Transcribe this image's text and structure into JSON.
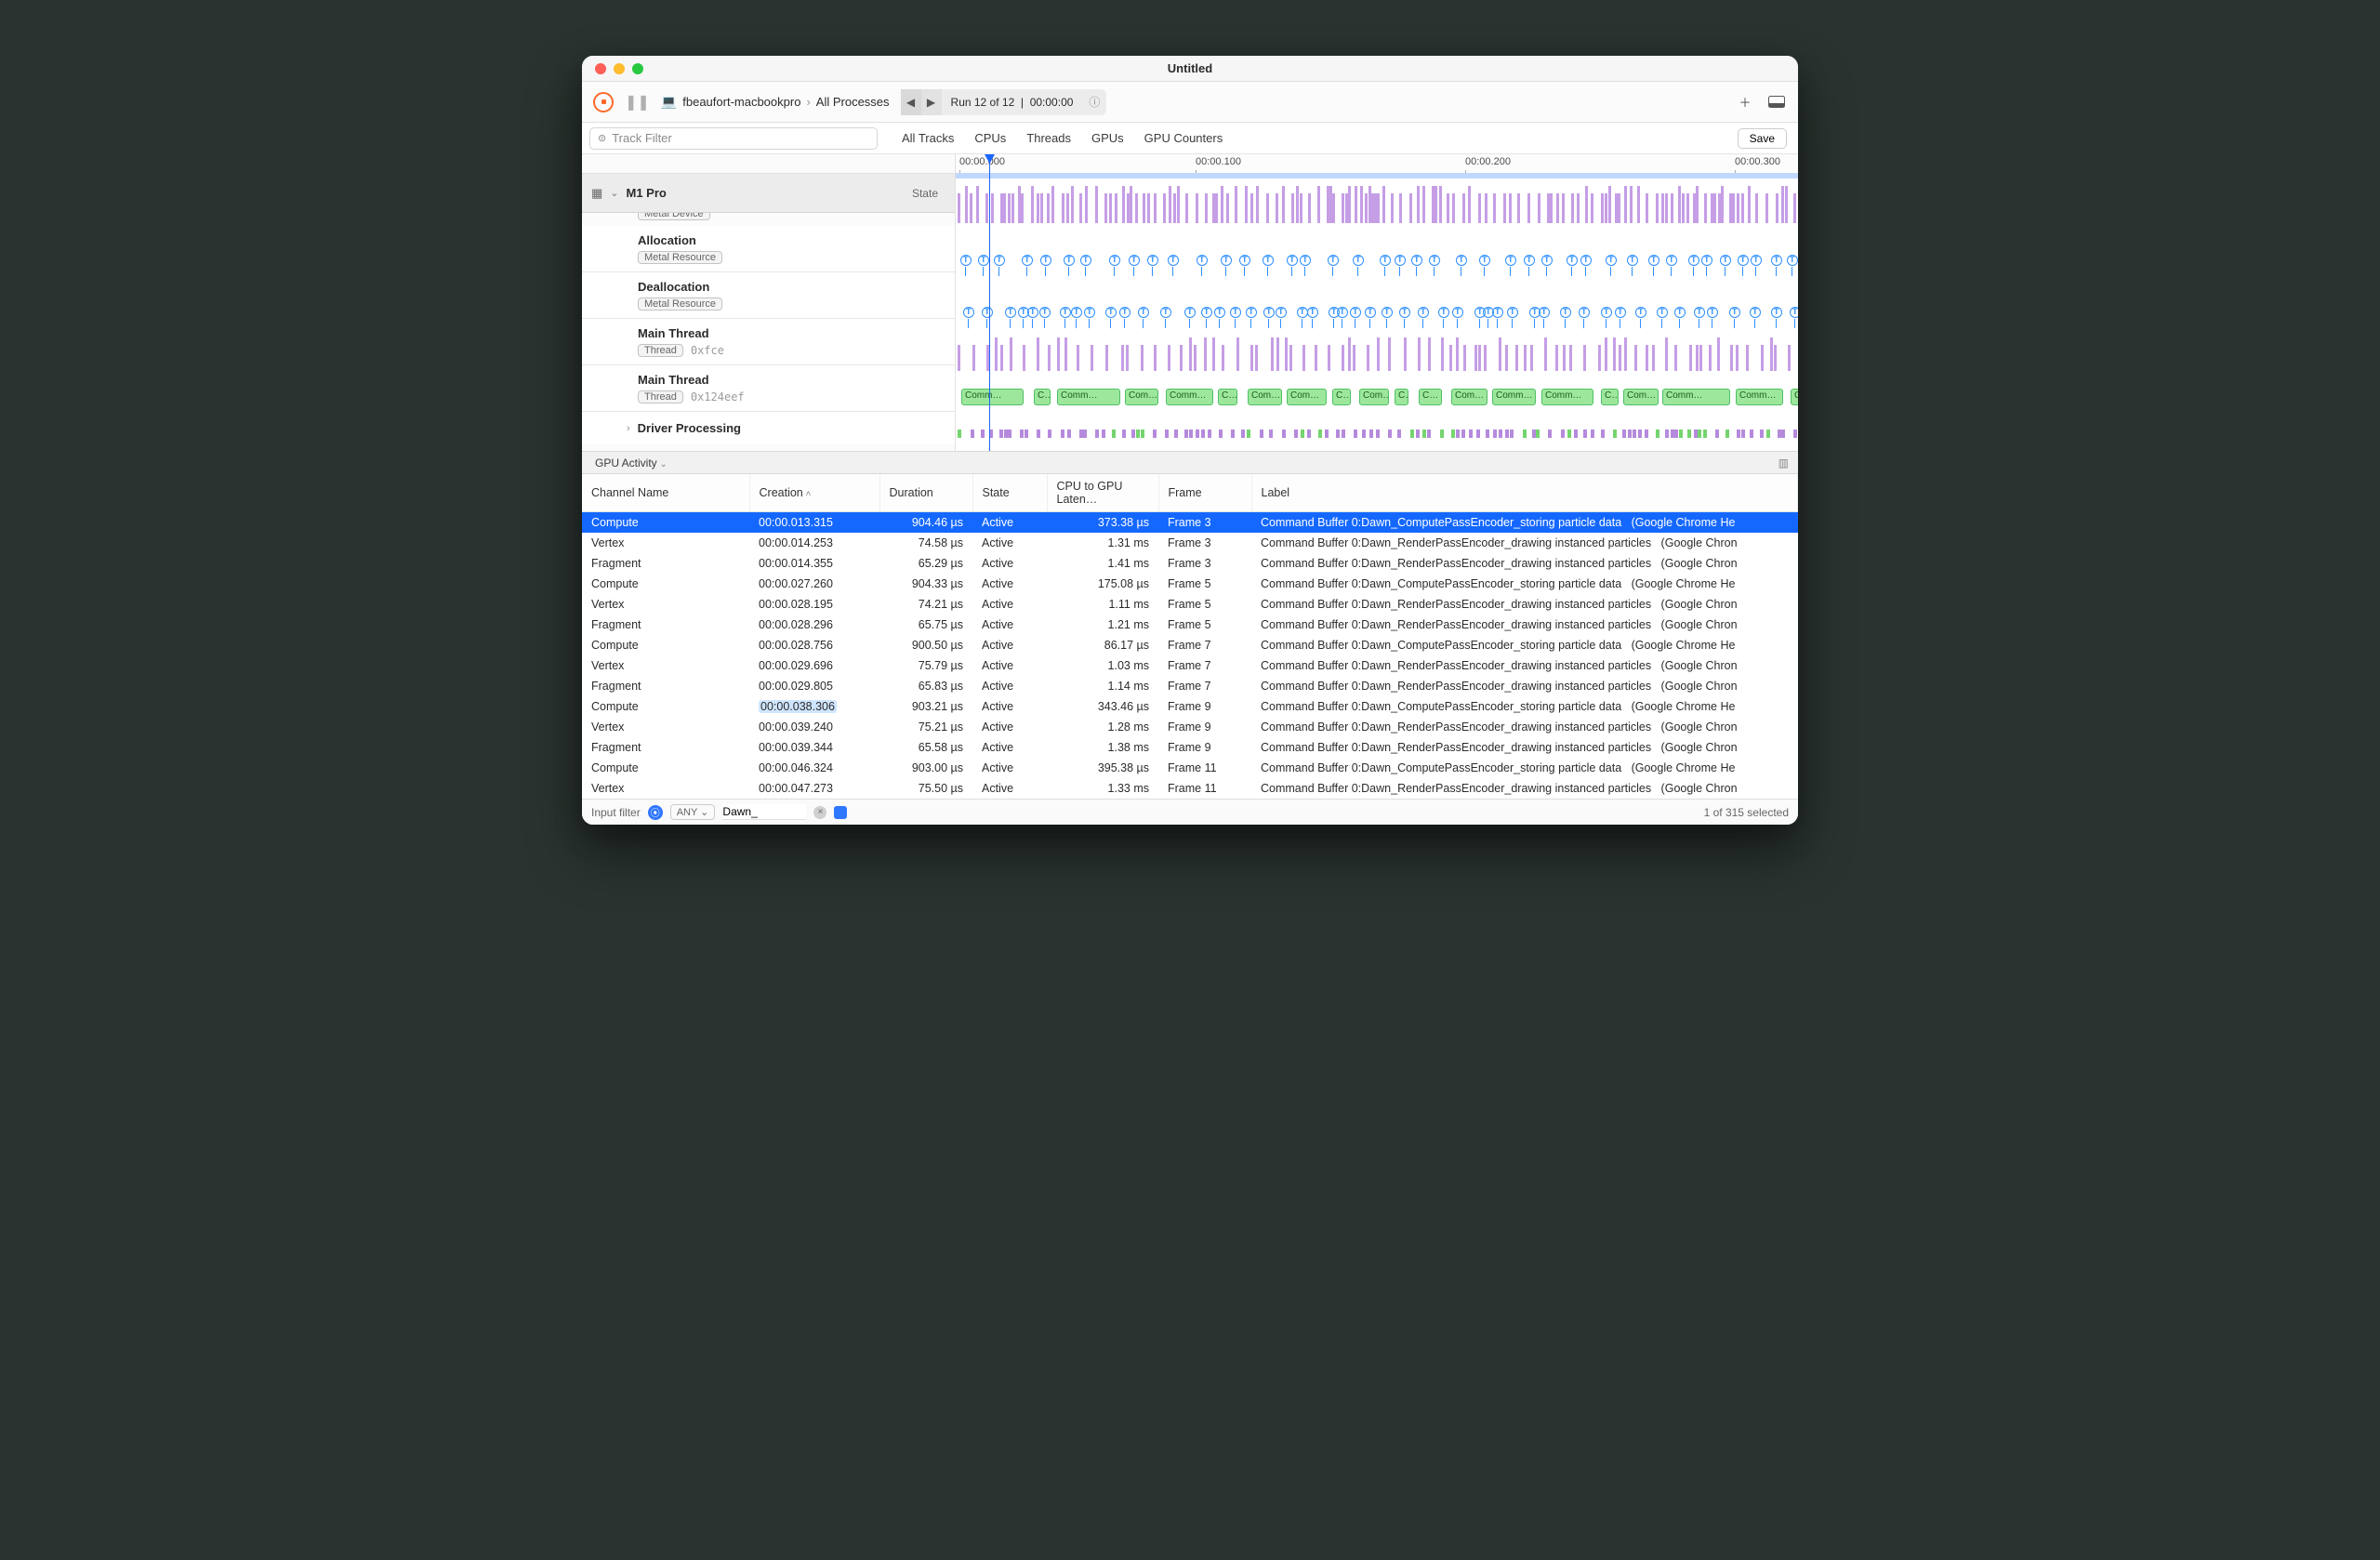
{
  "window": {
    "title": "Untitled"
  },
  "toolbar": {
    "host": "fbeaufort-macbookpro",
    "scope": "All Processes",
    "run_label": "Run 12 of 12",
    "run_time": "00:00:00"
  },
  "filter": {
    "placeholder": "Track Filter"
  },
  "tabs": [
    "All Tracks",
    "CPUs",
    "Threads",
    "GPUs",
    "GPU Counters"
  ],
  "save_label": "Save",
  "ruler_ticks": [
    "00:00.000",
    "00:00.100",
    "00:00.200",
    "00:00.300"
  ],
  "device": {
    "name": "M1 Pro",
    "badge": "Metal Device",
    "state": "State"
  },
  "channels": [
    {
      "title": "Allocation",
      "badge": "Metal Resource",
      "addr": ""
    },
    {
      "title": "Deallocation",
      "badge": "Metal Resource",
      "addr": ""
    },
    {
      "title": "Main Thread",
      "badge": "Thread",
      "addr": "0xfce"
    },
    {
      "title": "Main Thread",
      "badge": "Thread",
      "addr": "0x124eef"
    }
  ],
  "driver_label": "Driver Processing",
  "bottom": {
    "selector": "GPU Activity"
  },
  "columns": {
    "channel": "Channel Name",
    "creation": "Creation",
    "duration": "Duration",
    "state": "State",
    "latency": "CPU to GPU Laten…",
    "frame": "Frame",
    "label": "Label"
  },
  "rows": [
    {
      "ch": "Compute",
      "cr": "00:00.013.315",
      "du": "904.46 µs",
      "st": "Active",
      "la": "373.38 µs",
      "fr": "Frame 3",
      "lb": "Command Buffer 0:Dawn_ComputePassEncoder_storing particle data",
      "app": "(Google Chrome He",
      "sel": true
    },
    {
      "ch": "Vertex",
      "cr": "00:00.014.253",
      "du": "74.58 µs",
      "st": "Active",
      "la": "1.31 ms",
      "fr": "Frame 3",
      "lb": "Command Buffer 0:Dawn_RenderPassEncoder_drawing instanced particles",
      "app": "(Google Chron"
    },
    {
      "ch": "Fragment",
      "cr": "00:00.014.355",
      "du": "65.29 µs",
      "st": "Active",
      "la": "1.41 ms",
      "fr": "Frame 3",
      "lb": "Command Buffer 0:Dawn_RenderPassEncoder_drawing instanced particles",
      "app": "(Google Chron"
    },
    {
      "ch": "Compute",
      "cr": "00:00.027.260",
      "du": "904.33 µs",
      "st": "Active",
      "la": "175.08 µs",
      "fr": "Frame 5",
      "lb": "Command Buffer 0:Dawn_ComputePassEncoder_storing particle data",
      "app": "(Google Chrome He"
    },
    {
      "ch": "Vertex",
      "cr": "00:00.028.195",
      "du": "74.21 µs",
      "st": "Active",
      "la": "1.11 ms",
      "fr": "Frame 5",
      "lb": "Command Buffer 0:Dawn_RenderPassEncoder_drawing instanced particles",
      "app": "(Google Chron"
    },
    {
      "ch": "Fragment",
      "cr": "00:00.028.296",
      "du": "65.75 µs",
      "st": "Active",
      "la": "1.21 ms",
      "fr": "Frame 5",
      "lb": "Command Buffer 0:Dawn_RenderPassEncoder_drawing instanced particles",
      "app": "(Google Chron"
    },
    {
      "ch": "Compute",
      "cr": "00:00.028.756",
      "du": "900.50 µs",
      "st": "Active",
      "la": "86.17 µs",
      "fr": "Frame 7",
      "lb": "Command Buffer 0:Dawn_ComputePassEncoder_storing particle data",
      "app": "(Google Chrome He"
    },
    {
      "ch": "Vertex",
      "cr": "00:00.029.696",
      "du": "75.79 µs",
      "st": "Active",
      "la": "1.03 ms",
      "fr": "Frame 7",
      "lb": "Command Buffer 0:Dawn_RenderPassEncoder_drawing instanced particles",
      "app": "(Google Chron"
    },
    {
      "ch": "Fragment",
      "cr": "00:00.029.805",
      "du": "65.83 µs",
      "st": "Active",
      "la": "1.14 ms",
      "fr": "Frame 7",
      "lb": "Command Buffer 0:Dawn_RenderPassEncoder_drawing instanced particles",
      "app": "(Google Chron"
    },
    {
      "ch": "Compute",
      "cr": "00:00.038.306",
      "du": "903.21 µs",
      "st": "Active",
      "la": "343.46 µs",
      "fr": "Frame 9",
      "lb": "Command Buffer 0:Dawn_ComputePassEncoder_storing particle data",
      "app": "(Google Chrome He",
      "hl": true
    },
    {
      "ch": "Vertex",
      "cr": "00:00.039.240",
      "du": "75.21 µs",
      "st": "Active",
      "la": "1.28 ms",
      "fr": "Frame 9",
      "lb": "Command Buffer 0:Dawn_RenderPassEncoder_drawing instanced particles",
      "app": "(Google Chron"
    },
    {
      "ch": "Fragment",
      "cr": "00:00.039.344",
      "du": "65.58 µs",
      "st": "Active",
      "la": "1.38 ms",
      "fr": "Frame 9",
      "lb": "Command Buffer 0:Dawn_RenderPassEncoder_drawing instanced particles",
      "app": "(Google Chron"
    },
    {
      "ch": "Compute",
      "cr": "00:00.046.324",
      "du": "903.00 µs",
      "st": "Active",
      "la": "395.38 µs",
      "fr": "Frame 11",
      "lb": "Command Buffer 0:Dawn_ComputePassEncoder_storing particle data",
      "app": "(Google Chrome He"
    },
    {
      "ch": "Vertex",
      "cr": "00:00.047.273",
      "du": "75.50 µs",
      "st": "Active",
      "la": "1.33 ms",
      "fr": "Frame 11",
      "lb": "Command Buffer 0:Dawn_RenderPassEncoder_drawing instanced particles",
      "app": "(Google Chron"
    }
  ],
  "footer": {
    "input_label": "Input filter",
    "any": "ANY",
    "filter_value": "Dawn_",
    "status": "1 of 315 selected"
  },
  "cmd_label_short": "C…",
  "cmd_label_med": "Com…",
  "cmd_label_long": "Comm…"
}
